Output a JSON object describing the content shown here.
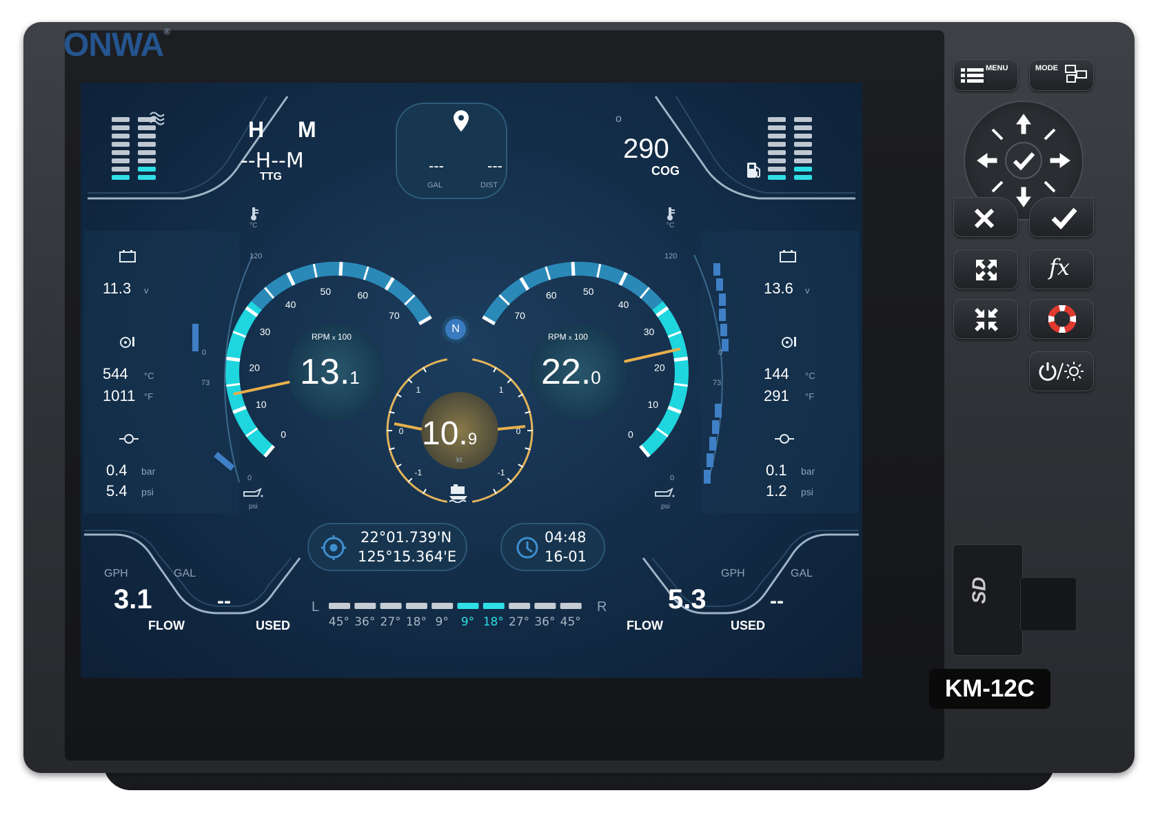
{
  "device": {
    "brand": "ONWA",
    "brand_mark": "®",
    "model": "KM-12C",
    "colors": {
      "brand": "#24558f",
      "accent_cyan": "#2ee0e6",
      "needle": "#e8b04a"
    }
  },
  "top_bar": {
    "ttg": {
      "h_label": "H",
      "m_label": "M",
      "value": "--H--M",
      "label": "TTG"
    },
    "waypoint": {
      "icon": "location-pin-icon",
      "gal_value": "---",
      "dist_value": "---",
      "gal_label": "GAL",
      "dist_label": "DIST"
    },
    "cog": {
      "value": "290",
      "degree_mark": "o",
      "label": "COG"
    },
    "left_tank_icon": "waves-icon",
    "right_tank_icon": "fuel-pump-icon"
  },
  "left_engine": {
    "battery": {
      "value": "11.3",
      "unit": "v"
    },
    "exhaust_temp": {
      "c_value": "544",
      "c_unit": "°C",
      "f_value": "1011",
      "f_unit": "°F"
    },
    "oil_pressure": {
      "bar_value": "0.4",
      "bar_unit": "bar",
      "psi_value": "5.4",
      "psi_unit": "psi"
    },
    "rpm": {
      "label_rpm": "RPM",
      "label_x": "x",
      "label_mult": "100",
      "value_main": "13.",
      "value_dec": "1",
      "fraction": 0.189
    },
    "rpm_ticks": [
      "0",
      "10",
      "20",
      "30",
      "40",
      "50",
      "60",
      "70"
    ],
    "coolant": {
      "unit": "°C",
      "max": "120",
      "min": "0"
    },
    "oil": {
      "max": "73",
      "min": "0",
      "unit": "psi"
    },
    "flow": {
      "gph_label": "GPH",
      "gal_label": "GAL",
      "flow_value": "3.1",
      "flow_label": "FLOW",
      "used_value": "--",
      "used_label": "USED"
    }
  },
  "right_engine": {
    "battery": {
      "value": "13.6",
      "unit": "v"
    },
    "exhaust_temp": {
      "c_value": "144",
      "c_unit": "°C",
      "f_value": "291",
      "f_unit": "°F"
    },
    "oil_pressure": {
      "bar_value": "0.1",
      "bar_unit": "bar",
      "psi_value": "1.2",
      "psi_unit": "psi"
    },
    "rpm": {
      "label_rpm": "RPM",
      "label_x": "x",
      "label_mult": "100",
      "value_main": "22.",
      "value_dec": "0",
      "fraction": 0.314
    },
    "rpm_ticks": [
      "0",
      "10",
      "20",
      "30",
      "40",
      "50",
      "60",
      "70"
    ],
    "coolant": {
      "unit": "°C",
      "max": "120",
      "min": "0"
    },
    "oil": {
      "max": "73",
      "min": "0",
      "unit": "psi"
    },
    "flow": {
      "gph_label": "GPH",
      "gal_label": "GAL",
      "flow_value": "5.3",
      "flow_label": "FLOW",
      "used_value": "--",
      "used_label": "USED"
    }
  },
  "speed": {
    "value_main": "10.",
    "value_dec": "9",
    "unit": "kt",
    "left_ticks": [
      "1",
      "0",
      "-1"
    ],
    "right_ticks": [
      "1",
      "0",
      "-1"
    ],
    "compass": "N"
  },
  "position": {
    "lat": "22°01.739'N",
    "lon": "125°15.364'E"
  },
  "clock": {
    "time": "04:48",
    "date": "16-01"
  },
  "rudder": {
    "left_label": "L",
    "right_label": "R",
    "scale": [
      "45°",
      "36°",
      "27°",
      "18°",
      "9°",
      "9°",
      "18°",
      "27°",
      "36°",
      "45°"
    ],
    "active": [
      5,
      6
    ]
  },
  "keys": {
    "menu": "MENU",
    "mode": "MODE",
    "fx": "fx"
  }
}
